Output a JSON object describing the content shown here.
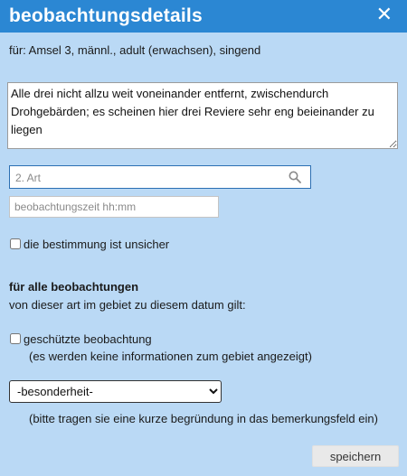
{
  "dialog": {
    "title": "beobachtungsdetails",
    "close_icon": "close-icon",
    "subtitle": "für: Amsel 3, männl., adult (erwachsen), singend"
  },
  "remarks": {
    "value": "Alle drei nicht allzu weit voneinander entfernt, zwischendurch Drohgebärden; es scheinen hier drei Reviere sehr eng beieinander zu liegen"
  },
  "species_search": {
    "placeholder": "2. Art",
    "icon": "search-icon"
  },
  "time_field": {
    "placeholder": "beobachtungszeit hh:mm"
  },
  "uncertain": {
    "label": "die bestimmung ist unsicher",
    "checked": false
  },
  "all_observations": {
    "heading": "für alle beobachtungen",
    "description": "von dieser art im gebiet zu diesem datum gilt:",
    "protected": {
      "label": "geschützte beobachtung",
      "note": "(es werden keine informationen zum gebiet angezeigt)",
      "checked": false
    },
    "special": {
      "selected": "-besonderheit-",
      "note": "(bitte tragen sie eine kurze begründung in das bemerkungsfeld ein)"
    }
  },
  "actions": {
    "save_label": "speichern"
  },
  "colors": {
    "titlebar": "#2b87d3",
    "background": "#bad9f5"
  }
}
